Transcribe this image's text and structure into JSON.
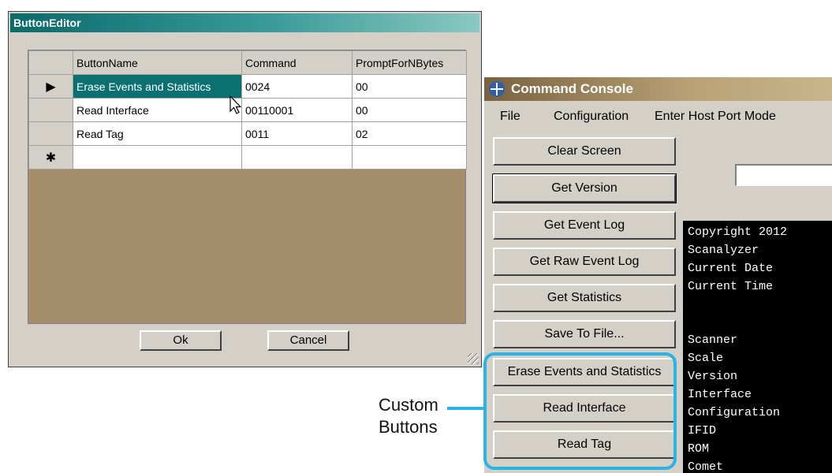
{
  "button_editor": {
    "title": "ButtonEditor",
    "columns": [
      "ButtonName",
      "Command",
      "PromptForNBytes"
    ],
    "rows": [
      {
        "marker": "▶",
        "name": "Erase Events and Statistics",
        "command": "0024",
        "prompt": "00"
      },
      {
        "marker": "",
        "name": "Read Interface",
        "command": "00110001",
        "prompt": "00"
      },
      {
        "marker": "",
        "name": "Read Tag",
        "command": "0011",
        "prompt": "02"
      }
    ],
    "new_row_marker": "✱",
    "ok_label": "Ok",
    "cancel_label": "Cancel"
  },
  "command_console": {
    "title": "Command Console",
    "menu": [
      "File",
      "Configuration",
      "Enter Host Port Mode"
    ],
    "buttons": [
      "Clear Screen",
      "Get Version",
      "Get Event Log",
      "Get Raw Event Log",
      "Get Statistics",
      "Save To File...",
      "Erase Events and Statistics",
      "Read Interface",
      "Read Tag"
    ],
    "terminal_lines": [
      "Copyright 2012",
      "Scanalyzer",
      "Current Date",
      "Current Time",
      "Scanner",
      "Scale",
      "Version",
      "Interface",
      "Configuration",
      "IFID",
      "ROM",
      "Comet"
    ]
  },
  "callout": {
    "label_line1": "Custom",
    "label_line2": "Buttons",
    "color": "#2ab4e6"
  }
}
